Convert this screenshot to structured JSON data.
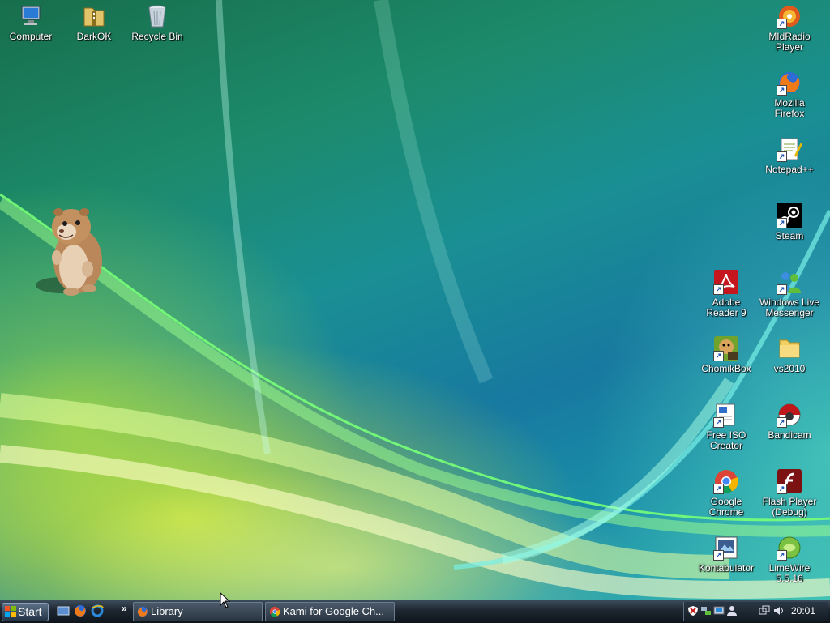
{
  "desktop": {
    "icons_left": [
      {
        "label": "Computer",
        "icon": "computer-icon"
      },
      {
        "label": "DarkOK",
        "icon": "archive-folder-icon"
      },
      {
        "label": "Recycle Bin",
        "icon": "recycle-bin-icon"
      }
    ],
    "icons_right": [
      {
        "label_lines": [
          "MIdRadio",
          "Player"
        ],
        "icon": "midradio-icon"
      },
      {
        "label_lines": [
          "Mozilla",
          "Firefox"
        ],
        "icon": "firefox-icon"
      },
      {
        "label_lines": [
          "Notepad++"
        ],
        "icon": "notepadpp-icon"
      },
      {
        "label_lines": [
          "Steam"
        ],
        "icon": "steam-icon"
      },
      {
        "label_lines": [
          "Adobe",
          "Reader 9"
        ],
        "icon": "adobe-reader-icon"
      },
      {
        "label_lines": [
          "Windows Live",
          "Messenger"
        ],
        "icon": "messenger-icon"
      },
      {
        "label_lines": [
          "ChomikBox"
        ],
        "icon": "chomikbox-icon"
      },
      {
        "label_lines": [
          "vs2010"
        ],
        "icon": "folder-icon"
      },
      {
        "label_lines": [
          "Free ISO",
          "Creator"
        ],
        "icon": "iso-creator-icon"
      },
      {
        "label_lines": [
          "Bandicam"
        ],
        "icon": "bandicam-icon"
      },
      {
        "label_lines": [
          "Google",
          "Chrome"
        ],
        "icon": "chrome-icon"
      },
      {
        "label_lines": [
          "Flash Player",
          "(Debug)"
        ],
        "icon": "flash-icon"
      },
      {
        "label_lines": [
          "Kontabulator"
        ],
        "icon": "kontabulator-icon"
      },
      {
        "label_lines": [
          "LimeWire",
          "5.5.16"
        ],
        "icon": "limewire-icon"
      }
    ]
  },
  "taskbar": {
    "start_label": "Start",
    "quick_launch": [
      "show-desktop-icon",
      "firefox-icon",
      "internet-explorer-icon"
    ],
    "more_label": "»",
    "tasks": [
      {
        "label": "Library",
        "icon": "firefox-icon"
      },
      {
        "label": "Kami for Google Ch...",
        "icon": "chrome-icon"
      }
    ],
    "tray_icons": [
      "shield-icon",
      "network-icon",
      "monitor-icon",
      "user-icon",
      "display-switch-icon",
      "speaker-icon"
    ],
    "clock": "20:01"
  },
  "colors": {
    "taskbar": "#1d2630",
    "accent": "#3c4b5a"
  }
}
